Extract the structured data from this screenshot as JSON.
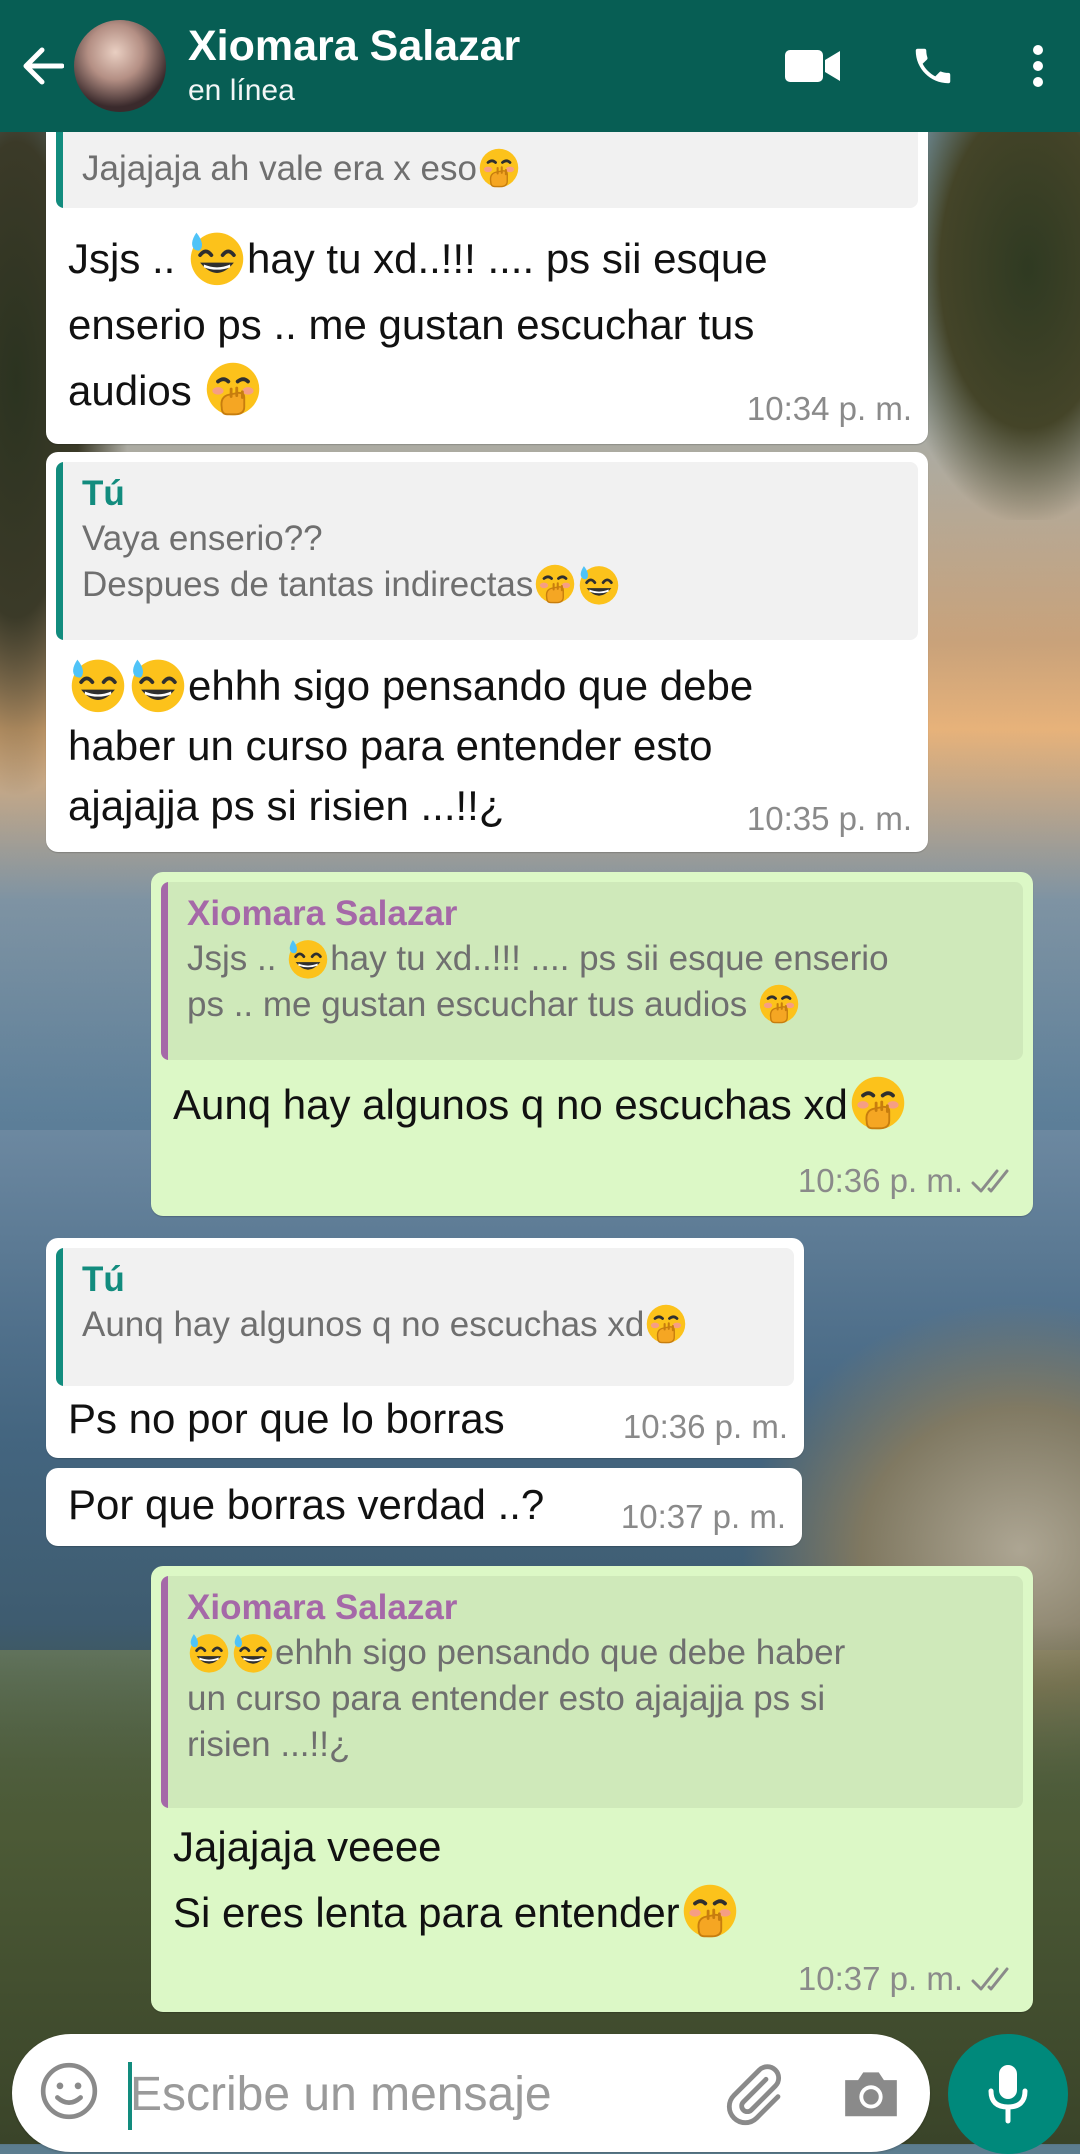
{
  "header": {
    "contact_name": "Xiomara Salazar",
    "status": "en línea",
    "colors": {
      "bar": "#075e54"
    }
  },
  "messages": [
    {
      "direction": "in",
      "quote_text": "Jajajaja ah vale era x eso",
      "body_lines": [
        "Jsjs .. ",
        "hay tu xd..!!! .... ps sii esque",
        "enserio ps .. me gustan escuchar tus",
        "audios "
      ],
      "time": "10:34 p. m."
    },
    {
      "direction": "in",
      "quote_author": "Tú",
      "quote_lines": [
        "Vaya enserio??",
        "Despues de tantas indirectas"
      ],
      "body_lines": [
        "ehhh sigo pensando que debe",
        "haber un curso para entender esto",
        "ajajajja ps si risien ...!!¿"
      ],
      "time": "10:35 p. m."
    },
    {
      "direction": "out",
      "quote_author": "Xiomara Salazar",
      "quote_lines": [
        "Jsjs .. ",
        "hay tu xd..!!! .... ps sii esque enserio",
        "ps .. me gustan escuchar tus audios "
      ],
      "body": "Aunq hay algunos q no escuchas xd",
      "time": "10:36 p. m."
    },
    {
      "direction": "in",
      "quote_author": "Tú",
      "quote_text": "Aunq hay algunos q no escuchas xd",
      "body": "Ps no por que lo borras",
      "time": "10:36 p. m."
    },
    {
      "direction": "in",
      "body": "Por que borras verdad ..?",
      "time": "10:37 p. m."
    },
    {
      "direction": "out",
      "quote_author": "Xiomara Salazar",
      "quote_lines": [
        "ehhh sigo pensando que debe haber",
        "un curso para entender esto ajajajja ps si",
        "risien ...!!¿"
      ],
      "body_lines": [
        "Jajajaja veeee",
        "Si eres lenta para entender"
      ],
      "time": "10:37 p. m."
    }
  ],
  "composer": {
    "placeholder": "Escribe un mensaje"
  },
  "icons": {
    "back": "arrow-left-icon",
    "video": "video-camera-icon",
    "call": "phone-icon",
    "menu": "more-vertical-icon",
    "emoji": "smiley-icon",
    "attach": "paperclip-icon",
    "camera": "camera-icon",
    "mic": "microphone-icon",
    "read": "double-check-icon"
  }
}
